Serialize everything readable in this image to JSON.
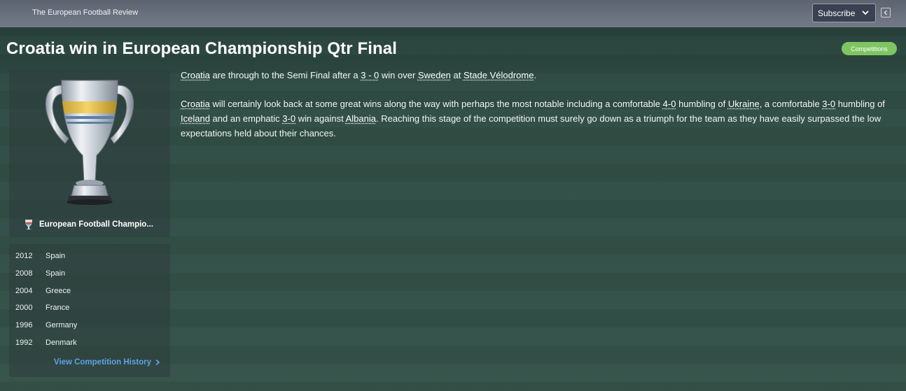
{
  "topbar": {
    "publication": "The European Football Review",
    "subscribe_label": "Subscribe"
  },
  "headline": "Croatia win in European Championship Qtr Final",
  "badge": "Competitions",
  "competition": {
    "name": "European Football Champio..."
  },
  "history": {
    "rows": [
      {
        "year": "2012",
        "winner": "Spain"
      },
      {
        "year": "2008",
        "winner": "Spain"
      },
      {
        "year": "2004",
        "winner": "Greece"
      },
      {
        "year": "2000",
        "winner": "France"
      },
      {
        "year": "1996",
        "winner": "Germany"
      },
      {
        "year": "1992",
        "winner": "Denmark"
      }
    ],
    "view_label": "View Competition History"
  },
  "article": {
    "p1": {
      "team": "Croatia",
      "t1": " are through to the Semi Final after a ",
      "score": "3 - 0",
      "t2": " win over ",
      "opponent": "Sweden",
      "t3": " at ",
      "stadium": "Stade Vélodrome",
      "t4": "."
    },
    "p2": {
      "team": "Croatia",
      "t1": " will certainly look back at some great wins along the way with perhaps the most notable including a comfortable ",
      "score1": "4-0",
      "t2": " humbling of ",
      "opp1": "Ukraine",
      "t3": ", a comfortable ",
      "score2": "3-0",
      "t4": " humbling of ",
      "opp2": "Iceland",
      "t5": " and an emphatic ",
      "score3": "3-0",
      "t6": " win against ",
      "opp3": "Albania",
      "t7": ". Reaching this stage of the competition must surely go down as a triumph for the team as they have easily surpassed the low expectations held about their chances."
    }
  },
  "icons": {
    "subscribe_chevron": "chevron-down-icon",
    "collapse": "collapse-panel-icon",
    "view_history_chevron": "chevron-right-icon",
    "trophy": "trophy-icon",
    "competition_logo": "competition-logo-icon"
  },
  "colors": {
    "badge": "#7ec562",
    "link": "#5aa5e6"
  }
}
